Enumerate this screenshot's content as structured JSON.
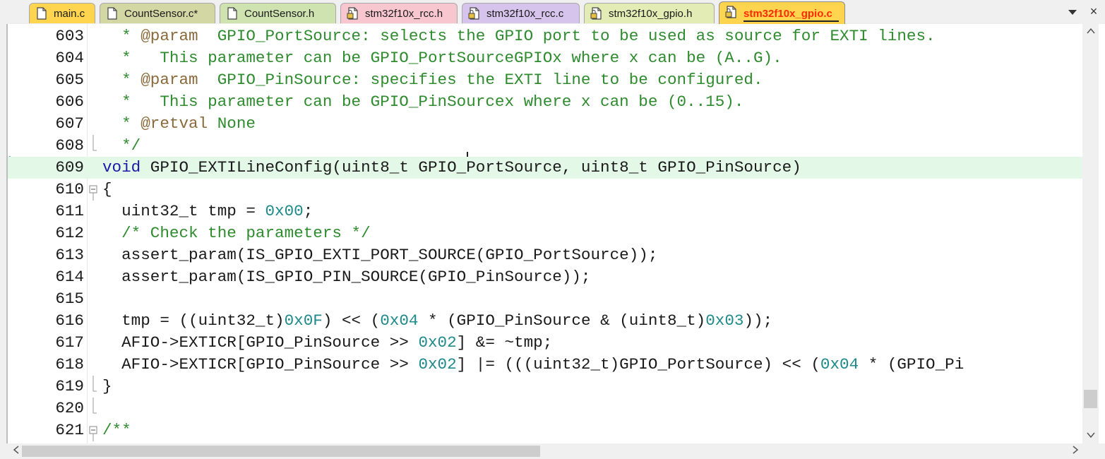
{
  "tabs": [
    {
      "label": "main.c",
      "color": "#ffd54f",
      "icon": "file-icon",
      "active": false
    },
    {
      "label": "CountSensor.c*",
      "color": "#d3d7a4",
      "icon": "file-icon",
      "active": false
    },
    {
      "label": "CountSensor.h",
      "color": "#cfe3b0",
      "icon": "file-icon",
      "active": false
    },
    {
      "label": "stm32f10x_rcc.h",
      "color": "#f7c6cf",
      "icon": "locked-file-icon",
      "active": false
    },
    {
      "label": "stm32f10x_rcc.c",
      "color": "#d6c4ec",
      "icon": "locked-file-icon",
      "active": false
    },
    {
      "label": "stm32f10x_gpio.h",
      "color": "#e2ecb4",
      "icon": "locked-file-icon",
      "active": false
    },
    {
      "label": "stm32f10x_gpio.c",
      "color": "#ffd54f",
      "icon": "locked-file-icon",
      "active": true
    }
  ],
  "tab_menu_icon": "chevron-down-icon",
  "tab_close_label": "×",
  "colors": {
    "comment": "#2e8b2e",
    "doc_tag": "#8a6a3a",
    "keyword": "#1a1aa8",
    "number": "#1e8a8a",
    "current_line_bg": "#e4f8e8",
    "active_tab_text": "#ff2a00"
  },
  "editor": {
    "current_line": 609,
    "lines": [
      {
        "num": "603",
        "fold": "none",
        "tokens": [
          [
            "comment",
            "  * "
          ],
          [
            "doc_tag",
            "@param"
          ],
          [
            "comment",
            "  GPIO_PortSource: selects the GPIO port to be used as source for EXTI lines."
          ]
        ]
      },
      {
        "num": "604",
        "fold": "none",
        "tokens": [
          [
            "comment",
            "  *   This parameter can be GPIO_PortSourceGPIOx where x can be (A..G)."
          ]
        ]
      },
      {
        "num": "605",
        "fold": "none",
        "tokens": [
          [
            "comment",
            "  * "
          ],
          [
            "doc_tag",
            "@param"
          ],
          [
            "comment",
            "  GPIO_PinSource: specifies the EXTI line to be configured."
          ]
        ]
      },
      {
        "num": "606",
        "fold": "none",
        "tokens": [
          [
            "comment",
            "  *   This parameter can be GPIO_PinSourcex where x can be (0..15)."
          ]
        ]
      },
      {
        "num": "607",
        "fold": "none",
        "tokens": [
          [
            "comment",
            "  * "
          ],
          [
            "doc_tag",
            "@retval"
          ],
          [
            "comment",
            " None"
          ]
        ]
      },
      {
        "num": "608",
        "fold": "end",
        "tokens": [
          [
            "comment",
            "  */"
          ]
        ]
      },
      {
        "num": "609",
        "fold": "none",
        "tokens": [
          [
            "keyword",
            "void"
          ],
          [
            "plain",
            " GPIO_EXTILineConfig(uint8_t GPIO_PortSource, uint8_t GPIO_PinSource)"
          ]
        ]
      },
      {
        "num": "610",
        "fold": "open",
        "tokens": [
          [
            "plain",
            "{"
          ]
        ]
      },
      {
        "num": "611",
        "fold": "none",
        "tokens": [
          [
            "plain",
            "  uint32_t tmp = "
          ],
          [
            "number",
            "0x00"
          ],
          [
            "plain",
            ";"
          ]
        ]
      },
      {
        "num": "612",
        "fold": "none",
        "tokens": [
          [
            "comment",
            "  /* Check the parameters */"
          ]
        ]
      },
      {
        "num": "613",
        "fold": "none",
        "tokens": [
          [
            "plain",
            "  assert_param(IS_GPIO_EXTI_PORT_SOURCE(GPIO_PortSource));"
          ]
        ]
      },
      {
        "num": "614",
        "fold": "none",
        "tokens": [
          [
            "plain",
            "  assert_param(IS_GPIO_PIN_SOURCE(GPIO_PinSource));"
          ]
        ]
      },
      {
        "num": "615",
        "fold": "none",
        "tokens": []
      },
      {
        "num": "616",
        "fold": "none",
        "tokens": [
          [
            "plain",
            "  tmp = ((uint32_t)"
          ],
          [
            "number",
            "0x0F"
          ],
          [
            "plain",
            ") << ("
          ],
          [
            "number",
            "0x04"
          ],
          [
            "plain",
            " * (GPIO_PinSource & (uint8_t)"
          ],
          [
            "number",
            "0x03"
          ],
          [
            "plain",
            "));"
          ]
        ]
      },
      {
        "num": "617",
        "fold": "none",
        "tokens": [
          [
            "plain",
            "  AFIO->EXTICR[GPIO_PinSource >> "
          ],
          [
            "number",
            "0x02"
          ],
          [
            "plain",
            "] &= ~tmp;"
          ]
        ]
      },
      {
        "num": "618",
        "fold": "none",
        "tokens": [
          [
            "plain",
            "  AFIO->EXTICR[GPIO_PinSource >> "
          ],
          [
            "number",
            "0x02"
          ],
          [
            "plain",
            "] |= (((uint32_t)GPIO_PortSource) << ("
          ],
          [
            "number",
            "0x04"
          ],
          [
            "plain",
            " * (GPIO_Pi"
          ]
        ]
      },
      {
        "num": "619",
        "fold": "end",
        "tokens": [
          [
            "plain",
            "}"
          ]
        ]
      },
      {
        "num": "620",
        "fold": "end",
        "tokens": []
      },
      {
        "num": "621",
        "fold": "open",
        "tokens": [
          [
            "comment",
            "/**"
          ]
        ]
      }
    ]
  },
  "scrollbars": {
    "vertical_position": 0.93,
    "horizontal_visible_fraction": 0.49
  }
}
